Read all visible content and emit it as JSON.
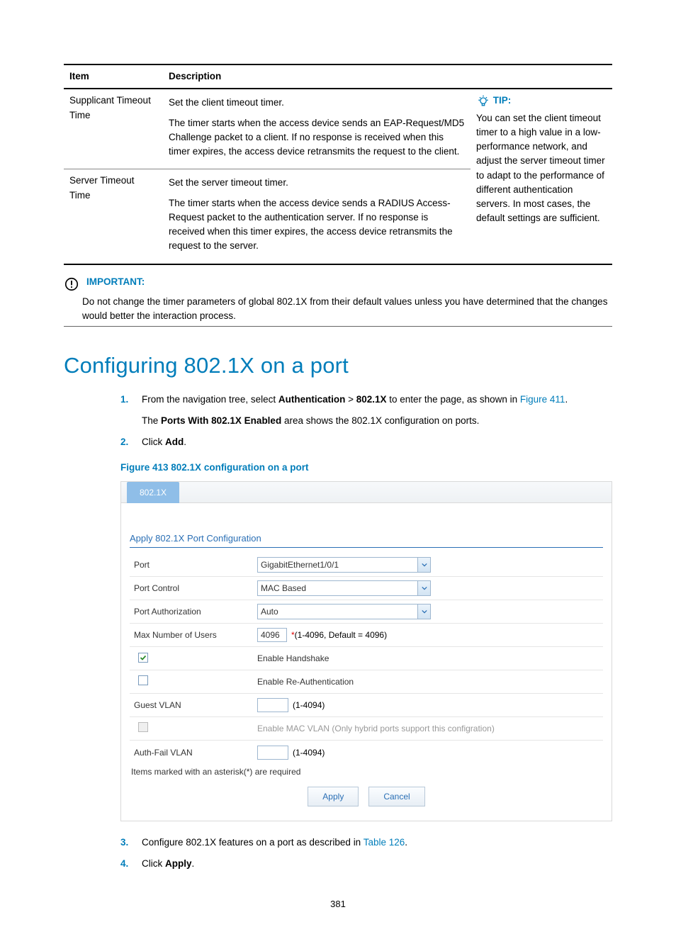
{
  "table": {
    "headers": {
      "item": "Item",
      "description": "Description"
    },
    "rows": [
      {
        "item": "Supplicant Timeout Time",
        "desc1": "Set the client timeout timer.",
        "desc2": "The timer starts when the access device sends an EAP-Request/MD5 Challenge packet to a client. If no response is received when this timer expires, the access device retransmits the request to the client."
      },
      {
        "item": "Server Timeout Time",
        "desc1": "Set the server timeout timer.",
        "desc2": "The timer starts when the access device sends a RADIUS Access-Request packet to the authentication server. If no response is received when this timer expires, the access device retransmits the request to the server."
      }
    ],
    "tip": {
      "label": "TIP:",
      "body": "You can set the client timeout timer to a high value in a low-performance network, and adjust the server timeout timer to adapt to the performance of different authentication servers. In most cases, the default settings are sufficient."
    }
  },
  "important": {
    "label": "IMPORTANT:",
    "body": "Do not change the timer parameters of global 802.1X from their default values unless you have determined that the changes would better the interaction process."
  },
  "section_title": "Configuring 802.1X on a port",
  "steps": {
    "s1a": "From the navigation tree, select ",
    "s1_auth": "Authentication",
    "s1_gt": " > ",
    "s1_8021x": "802.1X",
    "s1b": " to enter the page, as shown in ",
    "s1_figure_ref": "Figure 411",
    "s1_dot": ".",
    "s1c_a": "The ",
    "s1c_bold": "Ports With 802.1X Enabled",
    "s1c_b": " area shows the 802.1X configuration on ports.",
    "s2a": "Click ",
    "s2b": "Add",
    "s2c": ".",
    "s3a": "Configure 802.1X features on a port as described in ",
    "s3_ref": "Table 126",
    "s3b": ".",
    "s4a": "Click ",
    "s4b": "Apply",
    "s4c": "."
  },
  "figure": {
    "caption": "Figure 413 802.1X configuration on a port",
    "tab": "802.1X",
    "section_header": "Apply 802.1X Port Configuration",
    "rows": {
      "port_label": "Port",
      "port_value": "GigabitEthernet1/0/1",
      "port_control_label": "Port Control",
      "port_control_value": "MAC Based",
      "port_auth_label": "Port Authorization",
      "port_auth_value": "Auto",
      "max_users_label": "Max Number of Users",
      "max_users_value": "4096",
      "max_users_hint": "(1-4096, Default = 4096)",
      "enable_handshake": "Enable Handshake",
      "enable_reauth": "Enable Re-Authentication",
      "guest_vlan_label": "Guest VLAN",
      "vlan_hint": "(1-4094)",
      "mac_vlan": "Enable MAC VLAN (Only hybrid ports support this configration)",
      "auth_fail_vlan_label": "Auth-Fail VLAN"
    },
    "note": "Items marked with an asterisk(*) are required",
    "apply_btn": "Apply",
    "cancel_btn": "Cancel"
  },
  "page_number": "381"
}
